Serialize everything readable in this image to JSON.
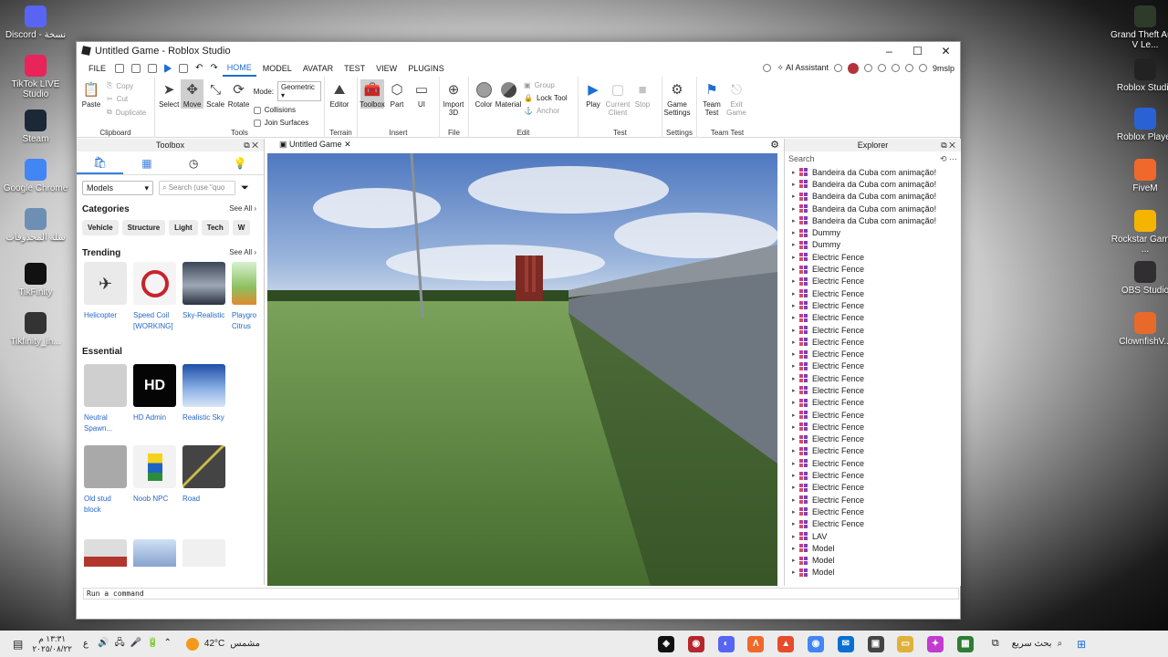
{
  "desktop_left": [
    {
      "label": "Discord - نسخة",
      "icon": "discord-icon",
      "color": "#5865f2"
    },
    {
      "label": "TikTok LIVE Studio",
      "icon": "tiktok-live-icon",
      "color": "#e8245a"
    },
    {
      "label": "Steam",
      "icon": "steam-icon",
      "color": "#1b2838"
    },
    {
      "label": "Google Chrome",
      "icon": "chrome-icon",
      "color": "#4285f4"
    },
    {
      "label": "سلة المحذوفات",
      "icon": "recycle-bin-icon",
      "color": "#6d8fb3"
    },
    {
      "label": "TikFinity",
      "icon": "tikfinity-icon",
      "color": "#111111"
    },
    {
      "label": "Tikfinity_in...",
      "icon": "tikfinity-installer-icon",
      "color": "#333333"
    }
  ],
  "desktop_right": [
    {
      "label": "Grand Theft Auto V Le...",
      "icon": "gta-icon",
      "color": "#2e3b2a"
    },
    {
      "label": "Roblox Studio",
      "icon": "roblox-studio-icon",
      "color": "#222222"
    },
    {
      "label": "Roblox Player",
      "icon": "roblox-player-icon",
      "color": "#2a62d6"
    },
    {
      "label": "FiveM",
      "icon": "fivem-icon",
      "color": "#f0692a"
    },
    {
      "label": "Rockstar Games ...",
      "icon": "rockstar-icon",
      "color": "#f4b400"
    },
    {
      "label": "OBS Studio",
      "icon": "obs-icon",
      "color": "#302e31"
    },
    {
      "label": "ClownfishV...",
      "icon": "clownfish-icon",
      "color": "#e86a2a"
    }
  ],
  "window": {
    "title": "Untitled Game - Roblox Studio",
    "menu": [
      "FILE",
      "HOME",
      "MODEL",
      "AVATAR",
      "TEST",
      "VIEW",
      "PLUGINS"
    ],
    "active_menu": "HOME",
    "ai_assistant": "AI Assistant",
    "username": "9mslp"
  },
  "ribbon": {
    "clipboard": {
      "name": "Clipboard",
      "paste": "Paste",
      "copy": "Copy",
      "cut": "Cut",
      "duplicate": "Duplicate"
    },
    "tools": {
      "name": "Tools",
      "select": "Select",
      "move": "Move",
      "scale": "Scale",
      "rotate": "Rotate",
      "mode_label": "Mode:",
      "mode_value": "Geometric",
      "collisions": "Collisions",
      "join_surfaces": "Join Surfaces"
    },
    "terrain": {
      "name": "Terrain",
      "editor": "Editor"
    },
    "insert": {
      "name": "Insert",
      "toolbox": "Toolbox",
      "part": "Part",
      "ui": "UI"
    },
    "file": {
      "name": "File",
      "import3d": "Import 3D"
    },
    "edit": {
      "name": "Edit",
      "color": "Color",
      "material": "Material",
      "group": "Group",
      "lock_tool": "Lock Tool",
      "anchor": "Anchor"
    },
    "test": {
      "name": "Test",
      "play": "Play",
      "current_client": "Current Client",
      "stop": "Stop"
    },
    "settings": {
      "name": "Settings",
      "game_settings": "Game Settings"
    },
    "team_test": {
      "name": "Team Test",
      "team_test": "Team Test",
      "exit_game": "Exit Game"
    }
  },
  "toolbox": {
    "title": "Toolbox",
    "dropdown": "Models",
    "search_placeholder": "Search (use \"quo",
    "categories_title": "Categories",
    "see_all": "See All",
    "categories": [
      "Vehicle",
      "Structure",
      "Light",
      "Tech",
      "W"
    ],
    "trending_title": "Trending",
    "trending": [
      "Helicopter",
      "Speed Coil [WORKING]",
      "Sky-Realistic",
      "Playgro Citrus"
    ],
    "essential_title": "Essential",
    "essential": [
      "Neutral Spawn...",
      "HD Admin",
      "Realistic Sky"
    ],
    "more": [
      "Old stud block",
      "Noob NPC",
      "Road"
    ],
    "hd_text": "HD"
  },
  "viewport": {
    "tab": "Untitled Game"
  },
  "explorer": {
    "title": "Explorer",
    "search_placeholder": "Search",
    "items": [
      "Bandeira da Cuba com animação!",
      "Bandeira da Cuba com animação!",
      "Bandeira da Cuba com animação!",
      "Bandeira da Cuba com animação!",
      "Bandeira da Cuba com animação!",
      "Dummy",
      "Dummy",
      "Electric Fence",
      "Electric Fence",
      "Electric Fence",
      "Electric Fence",
      "Electric Fence",
      "Electric Fence",
      "Electric Fence",
      "Electric Fence",
      "Electric Fence",
      "Electric Fence",
      "Electric Fence",
      "Electric Fence",
      "Electric Fence",
      "Electric Fence",
      "Electric Fence",
      "Electric Fence",
      "Electric Fence",
      "Electric Fence",
      "Electric Fence",
      "Electric Fence",
      "Electric Fence",
      "Electric Fence",
      "Electric Fence",
      "LAV",
      "Model",
      "Model",
      "Model"
    ]
  },
  "command_bar": {
    "placeholder": "Run a command"
  },
  "taskbar": {
    "time": "١٣:٣١ م",
    "date": "٢٠٢٥/٠٨/٢٢",
    "temp": "42°C",
    "weather": "مشمس",
    "search": "بحث سريع",
    "lang": "ع"
  }
}
